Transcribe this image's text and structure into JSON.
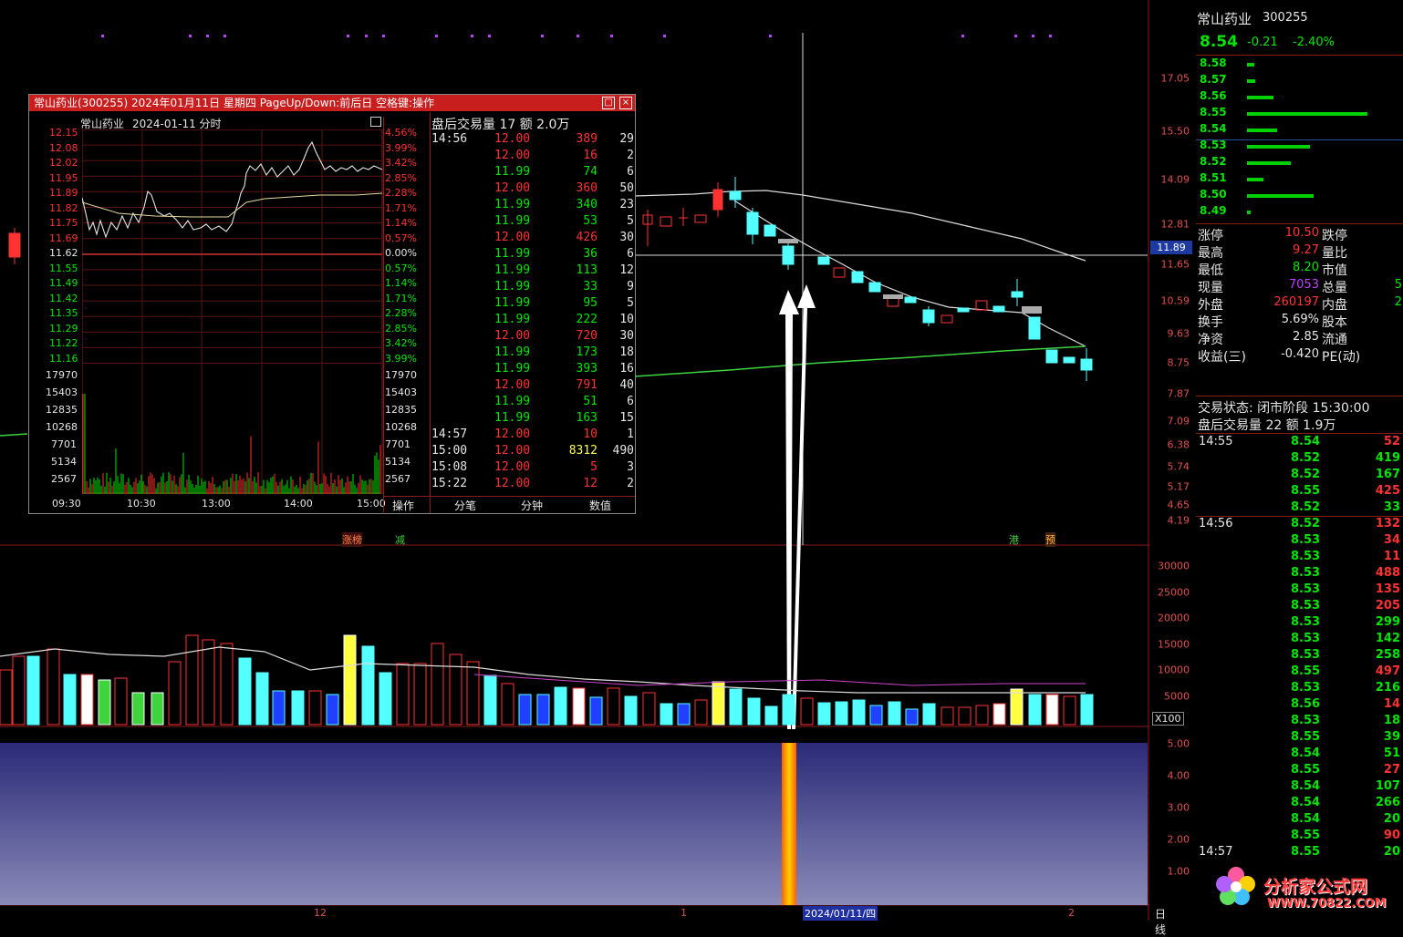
{
  "colors": {
    "up": "#ff3232",
    "down": "#54ffff",
    "flat": "#e6e6e6",
    "ma_green": "#3ed43e",
    "panel_bg": "#000000",
    "title_bar": "#c81e1e"
  },
  "price_axis": [
    "17.05",
    "15.50",
    "14.09",
    "12.81",
    "11.65",
    "10.59",
    "9.63",
    "8.75",
    "7.87",
    "7.09",
    "6.38",
    "5.74",
    "5.17",
    "4.65",
    "4.19"
  ],
  "price_marker": "11.89",
  "volume_axis": [
    "30000",
    "25000",
    "20000",
    "15000",
    "10000",
    "5000"
  ],
  "volume_unit": "X100",
  "indicator_axis": [
    "5.00",
    "4.00",
    "3.00",
    "2.00",
    "1.00"
  ],
  "event_tags": [
    {
      "text": "涨榜",
      "color": "#ff8040"
    },
    {
      "text": "减",
      "color": "#40d040"
    },
    {
      "text": "港",
      "color": "#40d040"
    },
    {
      "text": "预",
      "color": "#ffb040"
    }
  ],
  "x_axis": {
    "labels": [
      "12",
      "1",
      "2"
    ],
    "cursor_date": "2024/01/11/四",
    "period": "日线"
  },
  "popup": {
    "title": "常山药业(300255)  2024年01月11日  星期四  PageUp/Down:前后日  空格键:操作",
    "chart_header_name": "常山药业",
    "chart_header_date": "2024-01-11 分时",
    "price_ticks": [
      "12.15",
      "12.08",
      "12.02",
      "11.95",
      "11.89",
      "11.82",
      "11.75",
      "11.69",
      "11.62",
      "11.55",
      "11.49",
      "11.42",
      "11.35",
      "11.29",
      "11.22",
      "11.16"
    ],
    "pct_ticks": [
      "4.56%",
      "3.99%",
      "3.42%",
      "2.85%",
      "2.28%",
      "1.71%",
      "1.14%",
      "0.57%",
      "0.00%",
      "0.57%",
      "1.14%",
      "1.71%",
      "2.28%",
      "2.85%",
      "3.42%",
      "3.99%"
    ],
    "vol_ticks": [
      "17970",
      "15403",
      "12835",
      "10268",
      "7701",
      "5134",
      "2567"
    ],
    "time_ticks": [
      "09:30",
      "10:30",
      "13:00",
      "14:00",
      "15:00"
    ],
    "trade_header": "盘后交易量 17 额 2.0万",
    "trades": [
      {
        "time": "14:56",
        "price": "12.00",
        "vol": "389",
        "n": "29"
      },
      {
        "time": "",
        "price": "12.00",
        "vol": "16",
        "n": "2"
      },
      {
        "time": "",
        "price": "11.99",
        "vol": "74",
        "n": "6"
      },
      {
        "time": "",
        "price": "12.00",
        "vol": "360",
        "n": "50"
      },
      {
        "time": "",
        "price": "11.99",
        "vol": "340",
        "n": "23"
      },
      {
        "time": "",
        "price": "11.99",
        "vol": "53",
        "n": "5"
      },
      {
        "time": "",
        "price": "12.00",
        "vol": "426",
        "n": "30"
      },
      {
        "time": "",
        "price": "11.99",
        "vol": "36",
        "n": "6"
      },
      {
        "time": "",
        "price": "11.99",
        "vol": "113",
        "n": "12"
      },
      {
        "time": "",
        "price": "11.99",
        "vol": "33",
        "n": "9"
      },
      {
        "time": "",
        "price": "11.99",
        "vol": "95",
        "n": "5"
      },
      {
        "time": "",
        "price": "11.99",
        "vol": "222",
        "n": "10"
      },
      {
        "time": "",
        "price": "12.00",
        "vol": "720",
        "n": "30"
      },
      {
        "time": "",
        "price": "11.99",
        "vol": "173",
        "n": "18"
      },
      {
        "time": "",
        "price": "11.99",
        "vol": "393",
        "n": "16"
      },
      {
        "time": "",
        "price": "12.00",
        "vol": "791",
        "n": "40"
      },
      {
        "time": "",
        "price": "11.99",
        "vol": "51",
        "n": "6"
      },
      {
        "time": "",
        "price": "11.99",
        "vol": "163",
        "n": "15"
      },
      {
        "time": "14:57",
        "price": "12.00",
        "vol": "10",
        "n": "1"
      },
      {
        "time": "15:00",
        "price": "12.00",
        "vol": "8312",
        "n": "490"
      },
      {
        "time": "15:08",
        "price": "12.00",
        "vol": "5",
        "n": "3"
      },
      {
        "time": "15:22",
        "price": "12.00",
        "vol": "12",
        "n": "2"
      }
    ],
    "tabs": [
      "操作",
      "分笔",
      "分钟",
      "数值"
    ]
  },
  "right": {
    "name": "常山药业",
    "code": "300255",
    "price": "8.54",
    "change": "-0.21",
    "change_pct": "-2.40%",
    "asks": [
      {
        "p": "8.58",
        "b": 0.06
      },
      {
        "p": "8.57",
        "b": 0.07
      },
      {
        "p": "8.56",
        "b": 0.22
      },
      {
        "p": "8.55",
        "b": 1.0
      },
      {
        "p": "8.54",
        "b": 0.25
      }
    ],
    "bids": [
      {
        "p": "8.53",
        "b": 0.52
      },
      {
        "p": "8.52",
        "b": 0.36
      },
      {
        "p": "8.51",
        "b": 0.14
      },
      {
        "p": "8.50",
        "b": 0.55
      },
      {
        "p": "8.49",
        "b": 0.03
      }
    ],
    "stats": [
      {
        "l": "涨停",
        "v": "10.50",
        "vc": "#ff3232",
        "l2": "跌停",
        "v2": ""
      },
      {
        "l": "最高",
        "v": "9.27",
        "vc": "#ff3232",
        "l2": "量比",
        "v2": ""
      },
      {
        "l": "最低",
        "v": "8.20",
        "vc": "#00e600",
        "l2": "市值",
        "v2": ""
      },
      {
        "l": "现量",
        "v": "7053",
        "vc": "#c040ff",
        "l2": "总量",
        "v2": "5"
      },
      {
        "l": "外盘",
        "v": "260197",
        "vc": "#ff3232",
        "l2": "内盘",
        "v2": "2"
      },
      {
        "l": "换手",
        "v": "5.69%",
        "vc": "#e6e6e6",
        "l2": "股本",
        "v2": ""
      },
      {
        "l": "净资",
        "v": "2.85",
        "vc": "#e6e6e6",
        "l2": "流通",
        "v2": ""
      },
      {
        "l": "收益(三)",
        "v": "-0.420",
        "vc": "#e6e6e6",
        "l2": "PE(动)",
        "v2": ""
      }
    ],
    "status": "交易状态: 闭市阶段 15:30:00",
    "after_hours": "盘后交易量 22 额 1.9万",
    "ticks": [
      {
        "t": "14:55",
        "p": "8.54",
        "v": "52",
        "c": "r"
      },
      {
        "t": "",
        "p": "8.52",
        "v": "419",
        "c": "g"
      },
      {
        "t": "",
        "p": "8.52",
        "v": "167",
        "c": "g"
      },
      {
        "t": "",
        "p": "8.55",
        "v": "425",
        "c": "r"
      },
      {
        "t": "",
        "p": "8.52",
        "v": "33",
        "c": "g"
      },
      {
        "t": "14:56",
        "p": "8.52",
        "v": "132",
        "c": "r"
      },
      {
        "t": "",
        "p": "8.53",
        "v": "34",
        "c": "r"
      },
      {
        "t": "",
        "p": "8.53",
        "v": "11",
        "c": "r"
      },
      {
        "t": "",
        "p": "8.53",
        "v": "488",
        "c": "r"
      },
      {
        "t": "",
        "p": "8.53",
        "v": "135",
        "c": "r"
      },
      {
        "t": "",
        "p": "8.53",
        "v": "205",
        "c": "r"
      },
      {
        "t": "",
        "p": "8.53",
        "v": "299",
        "c": "g"
      },
      {
        "t": "",
        "p": "8.53",
        "v": "142",
        "c": "g"
      },
      {
        "t": "",
        "p": "8.53",
        "v": "258",
        "c": "g"
      },
      {
        "t": "",
        "p": "8.55",
        "v": "497",
        "c": "r"
      },
      {
        "t": "",
        "p": "8.53",
        "v": "216",
        "c": "g"
      },
      {
        "t": "",
        "p": "8.56",
        "v": "14",
        "c": "r"
      },
      {
        "t": "",
        "p": "8.53",
        "v": "18",
        "c": "g"
      },
      {
        "t": "",
        "p": "8.55",
        "v": "39",
        "c": "g"
      },
      {
        "t": "",
        "p": "8.54",
        "v": "51",
        "c": "g"
      },
      {
        "t": "",
        "p": "8.55",
        "v": "27",
        "c": "r"
      },
      {
        "t": "",
        "p": "8.54",
        "v": "107",
        "c": "g"
      },
      {
        "t": "",
        "p": "8.54",
        "v": "266",
        "c": "g"
      },
      {
        "t": "",
        "p": "8.54",
        "v": "20",
        "c": "g"
      },
      {
        "t": "",
        "p": "8.55",
        "v": "90",
        "c": "r"
      },
      {
        "t": "14:57",
        "p": "8.55",
        "v": "20",
        "c": "g"
      }
    ],
    "watermark_main": "分析家公式网",
    "watermark_url": "WWW.70822.COM"
  }
}
